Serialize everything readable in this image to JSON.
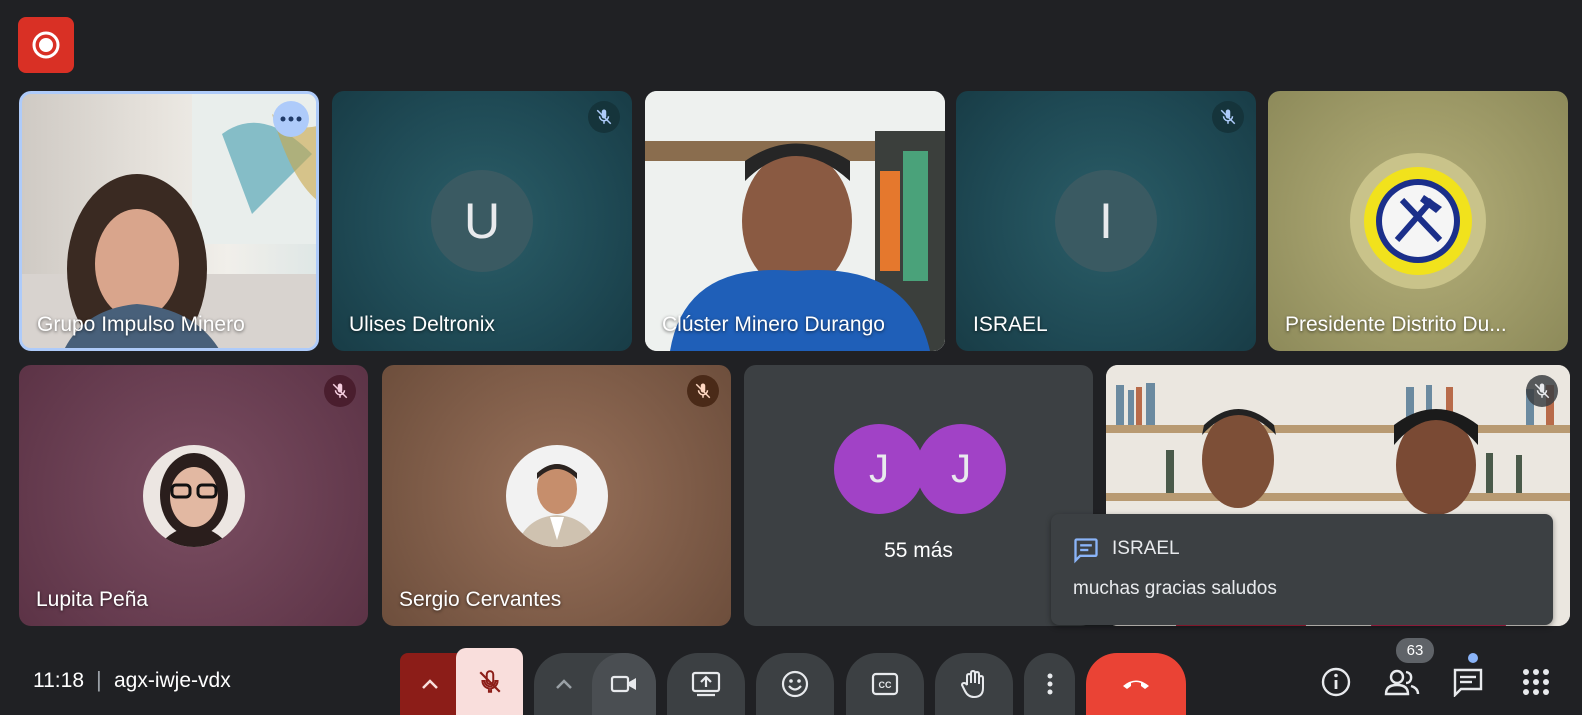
{
  "top": {
    "record_indicator": "record-icon"
  },
  "tiles_row1": [
    {
      "name": "Grupo Impulso Minero",
      "type": "video"
    },
    {
      "name": "Ulises Deltronix",
      "initial": "U",
      "muted": true
    },
    {
      "name": "Clúster Minero Durango",
      "type": "video"
    },
    {
      "name": "ISRAEL",
      "initial": "I",
      "muted": true
    },
    {
      "name": "Presidente Distrito Du...",
      "type": "logo"
    }
  ],
  "tiles_row2": [
    {
      "name": "Lupita Peña",
      "type": "photo",
      "muted": true
    },
    {
      "name": "Sergio Cervantes",
      "type": "photo",
      "muted": true
    },
    {
      "more_label": "55 más",
      "initials": [
        "J",
        "J"
      ]
    },
    {
      "type": "video",
      "muted": true
    }
  ],
  "chat_popup": {
    "sender": "ISRAEL",
    "message": "muchas gracias saludos"
  },
  "bottom": {
    "time": "11:18",
    "separator": "|",
    "meeting_code": "agx-iwje-vdx",
    "participants_count": "63"
  },
  "colors": {
    "background": "#202124",
    "end_call": "#ea4335",
    "mic_off_bg": "#f9dedc",
    "mic_menu_bg": "#8c1d18",
    "avatar_purple": "#a142c6"
  }
}
